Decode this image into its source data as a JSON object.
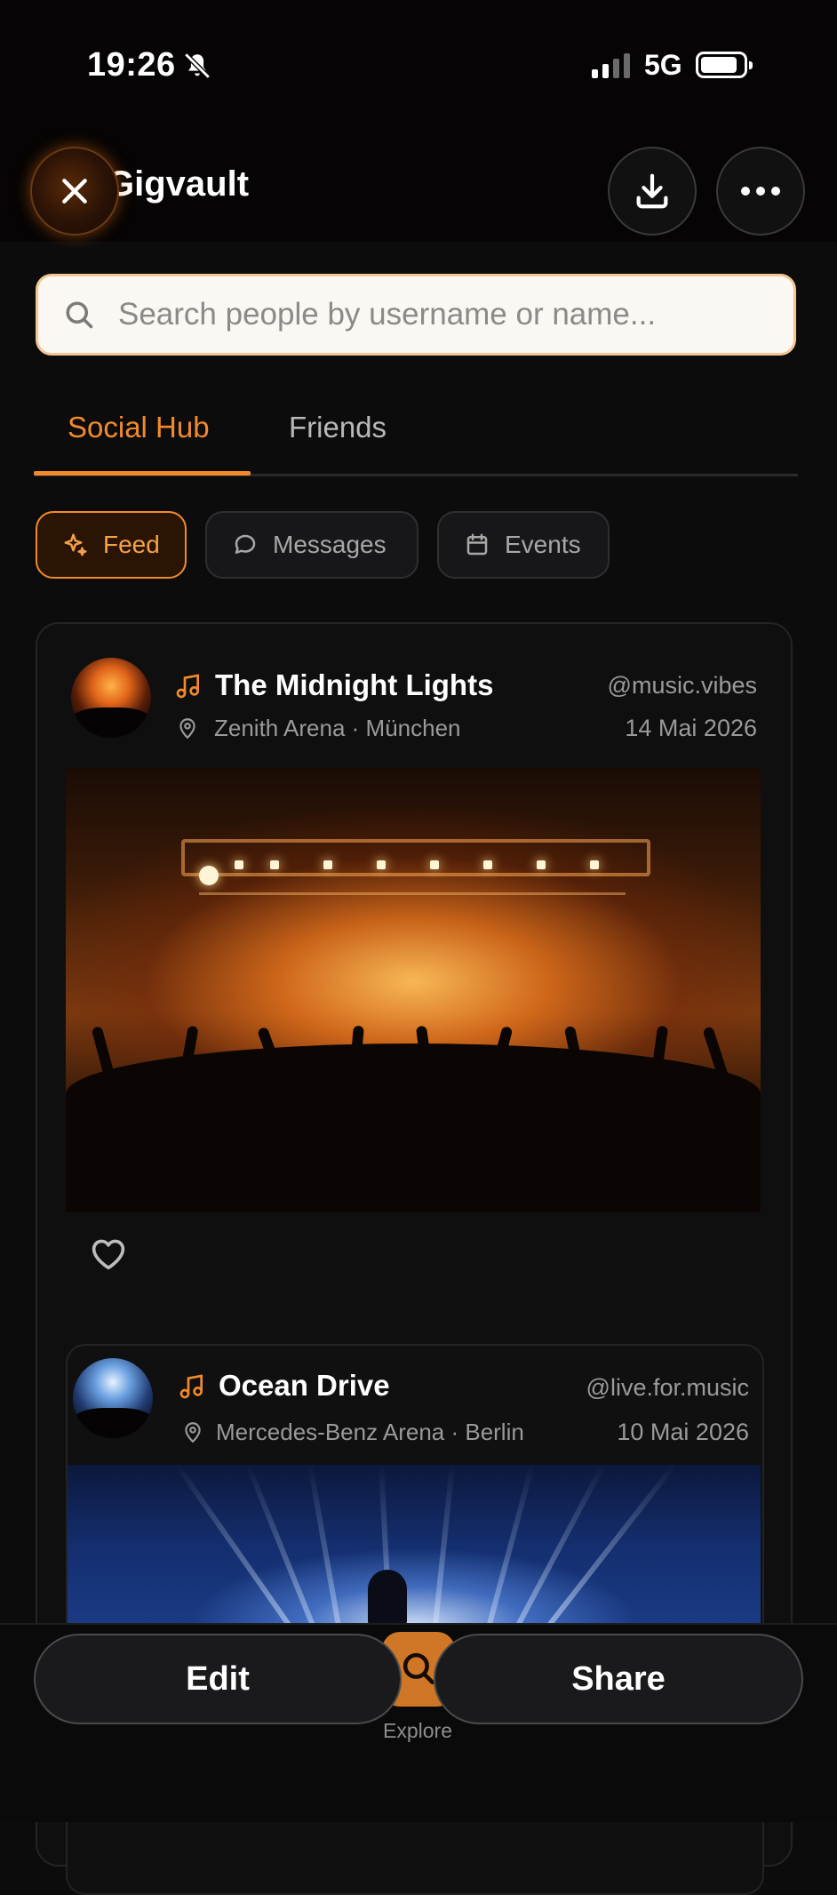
{
  "status_bar": {
    "time": "19:26",
    "network": "5G"
  },
  "header": {
    "title": "Gigvault"
  },
  "search": {
    "placeholder": "Search people by username or name..."
  },
  "tabs": [
    {
      "label": "Social Hub",
      "active": true
    },
    {
      "label": "Friends",
      "active": false
    }
  ],
  "filters": [
    {
      "label": "Feed",
      "icon": "sparkle-icon",
      "active": true
    },
    {
      "label": "Messages",
      "icon": "chat-bubble-icon",
      "active": false
    },
    {
      "label": "Events",
      "icon": "calendar-icon",
      "active": false
    }
  ],
  "posts": [
    {
      "title": "The Midnight Lights",
      "location": "Zenith Arena · München",
      "username": "@music.vibes",
      "date": "14 Mai 2026"
    },
    {
      "title": "Ocean Drive",
      "location": "Mercedes-Benz Arena · Berlin",
      "username": "@live.for.music",
      "date": "10 Mai 2026"
    }
  ],
  "bottom_nav": {
    "explore_label": "Explore"
  },
  "actions": {
    "edit_label": "Edit",
    "share_label": "Share"
  },
  "colors": {
    "accent": "#f28a2b",
    "background": "#0c0c0d",
    "card_border": "#242426"
  }
}
